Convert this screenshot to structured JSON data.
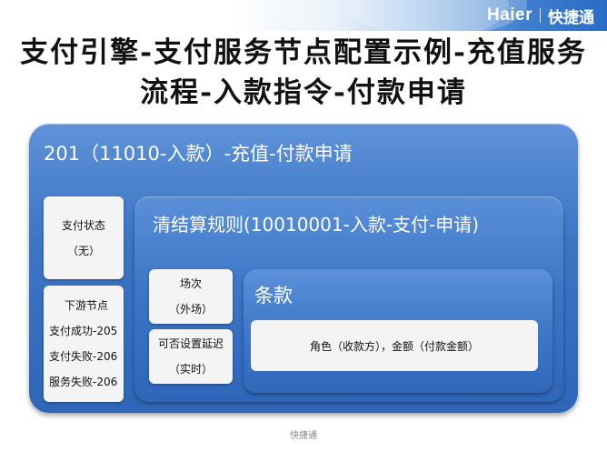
{
  "header": {
    "brand_logo": "Haier",
    "brand_name": "快捷通"
  },
  "title": "支付引擎-支付服务节点配置示例-充值服务流程-入款指令-付款申请",
  "outer": {
    "title": "201（11010-入款）-充值-付款申请"
  },
  "status_card": {
    "line1": "支付状态",
    "line2": "（无）"
  },
  "downstream_card": {
    "heading": "下游节点",
    "items": [
      "支付成功-205",
      "支付失败-206",
      "服务失败-206"
    ]
  },
  "inner": {
    "title": "清结算规则(10010001-入款-支付-申请)"
  },
  "scene_card": {
    "line1": "场次",
    "line2": "（外场）"
  },
  "delay_card": {
    "line1": "可否设置延迟",
    "line2": "（实时）"
  },
  "clause": {
    "title": "条款",
    "content": "角色（收款方），金额（付款金额）"
  },
  "footer": {
    "text": "快捷通"
  }
}
